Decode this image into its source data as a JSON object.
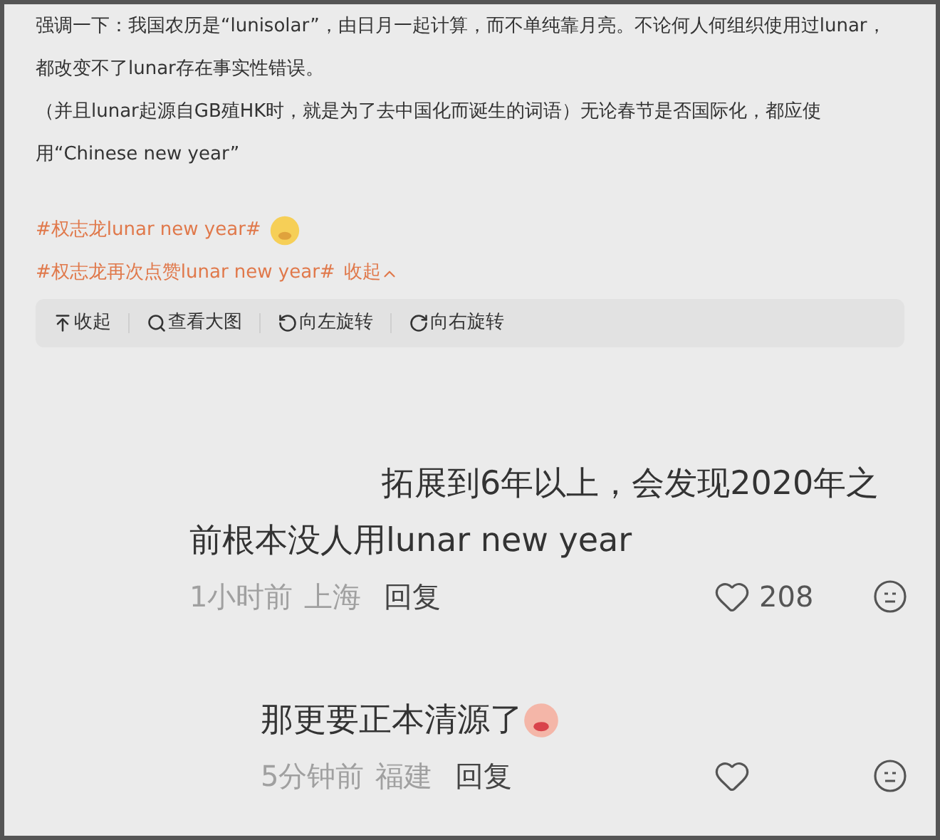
{
  "post": {
    "paragraphs": [
      "强调一下：我国农历是“lunisolar”，由日月一起计算，而不单纯靠月亮。不论何人何组织使用过lunar，都改变不了lunar存在事实性错误。",
      "（并且lunar起源自GB殖HK时，就是为了去中国化而诞生的词语）无论春节是否国际化，都应使用“Chinese new year”"
    ],
    "hashtags": [
      {
        "text": "#权志龙lunar new year#",
        "sticker": true
      },
      {
        "text": "#权志龙再次点赞lunar new year#",
        "sticker": false,
        "collapse": "收起"
      }
    ]
  },
  "toolbar": [
    {
      "label": "收起"
    },
    {
      "label": "查看大图"
    },
    {
      "label": "向左旋转"
    },
    {
      "label": "向右旋转"
    }
  ],
  "comments": [
    {
      "text": "拓展到6年以上，会发现2020年之前根本没人用lunar new year",
      "sticker": false,
      "time": "1小时前",
      "location": "上海",
      "reply": "回复",
      "likes": "208",
      "children": [
        {
          "text": "那更要正本清源了",
          "sticker": true,
          "time": "5分钟前",
          "location": "福建",
          "reply": "回复"
        }
      ]
    }
  ]
}
